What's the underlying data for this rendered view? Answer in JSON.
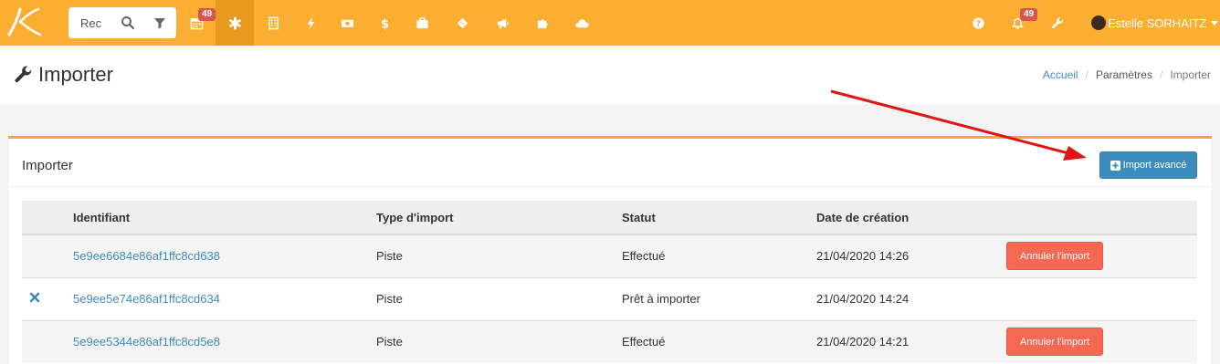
{
  "colors": {
    "topbar": "#fbae31",
    "topbar_active": "#e89a1f",
    "link": "#3c8dbc",
    "primary_button": "#3c8dbc",
    "danger_button": "#f56954",
    "badge": "#d9534f",
    "annotation_arrow": "#e31414"
  },
  "topbar": {
    "logo_icon": "k-logo-icon",
    "search": {
      "value": "Rec",
      "icon": "search-icon",
      "filter_icon": "filter-icon"
    },
    "nav": [
      {
        "icon": "calendar-icon",
        "badge": "49"
      },
      {
        "icon": "asterisk-icon",
        "active": true
      },
      {
        "icon": "building-icon"
      },
      {
        "icon": "bolt-icon"
      },
      {
        "icon": "money-icon"
      },
      {
        "icon": "dollar-icon"
      },
      {
        "icon": "briefcase-icon"
      },
      {
        "icon": "ticket-icon"
      },
      {
        "icon": "megaphone-icon"
      },
      {
        "icon": "puzzle-icon"
      },
      {
        "icon": "cloud-icon"
      }
    ],
    "right": {
      "help_icon": "question-circle-icon",
      "notifications": {
        "icon": "bell-icon",
        "badge": "49"
      },
      "settings_icon": "wrench-icon",
      "user_name": "Estelle SORHAITZ"
    }
  },
  "header": {
    "title": "Importer",
    "title_icon": "wrench-icon",
    "breadcrumb": [
      {
        "label": "Accueil",
        "link": true
      },
      {
        "label": "Paramètres",
        "link": false
      },
      {
        "label": "Importer",
        "link": false
      }
    ]
  },
  "box": {
    "title": "Importer",
    "advanced_button": "Import avancé",
    "advanced_icon": "plus-square-icon",
    "columns": [
      "",
      "Identifiant",
      "Type d'import",
      "Statut",
      "Date de création",
      ""
    ],
    "rows": [
      {
        "id": "5e9ee6684e86af1ffc8cd638",
        "type": "Piste",
        "status": "Effectué",
        "date": "21/04/2020 14:26",
        "action": "Annuler l'import",
        "remove": false
      },
      {
        "id": "5e9ee5e74e86af1ffc8cd634",
        "type": "Piste",
        "status": "Prêt à importer",
        "date": "21/04/2020 14:24",
        "action": "",
        "remove": true
      },
      {
        "id": "5e9ee5344e86af1ffc8cd5e8",
        "type": "Piste",
        "status": "Effectué",
        "date": "21/04/2020 14:21",
        "action": "Annuler l'import",
        "remove": false
      }
    ]
  }
}
